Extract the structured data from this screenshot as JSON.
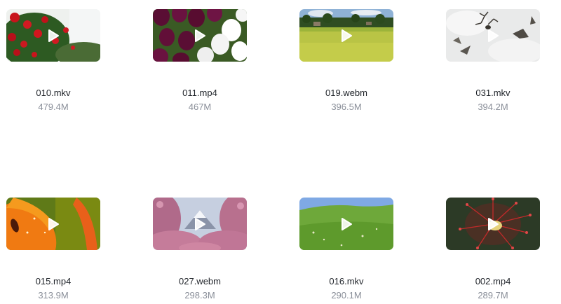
{
  "videos": [
    {
      "name": "010.mkv",
      "size": "479.4M",
      "thumb_icon": "red-roses-thumbnail"
    },
    {
      "name": "011.mp4",
      "size": "467M",
      "thumb_icon": "tulips-thumbnail"
    },
    {
      "name": "019.webm",
      "size": "396.5M",
      "thumb_icon": "rice-field-thumbnail"
    },
    {
      "name": "031.mkv",
      "size": "394.2M",
      "thumb_icon": "snow-plant-thumbnail"
    },
    {
      "name": "015.mp4",
      "size": "313.9M",
      "thumb_icon": "orange-lily-thumbnail"
    },
    {
      "name": "027.webm",
      "size": "298.3M",
      "thumb_icon": "cherry-blossom-mountain-thumbnail"
    },
    {
      "name": "016.mkv",
      "size": "290.1M",
      "thumb_icon": "green-meadow-thumbnail"
    },
    {
      "name": "002.mp4",
      "size": "289.7M",
      "thumb_icon": "sundew-plant-thumbnail"
    }
  ],
  "colors": {
    "filename": "#1f2329",
    "filesize": "#8a8f99",
    "play_icon": "#ffffff"
  }
}
